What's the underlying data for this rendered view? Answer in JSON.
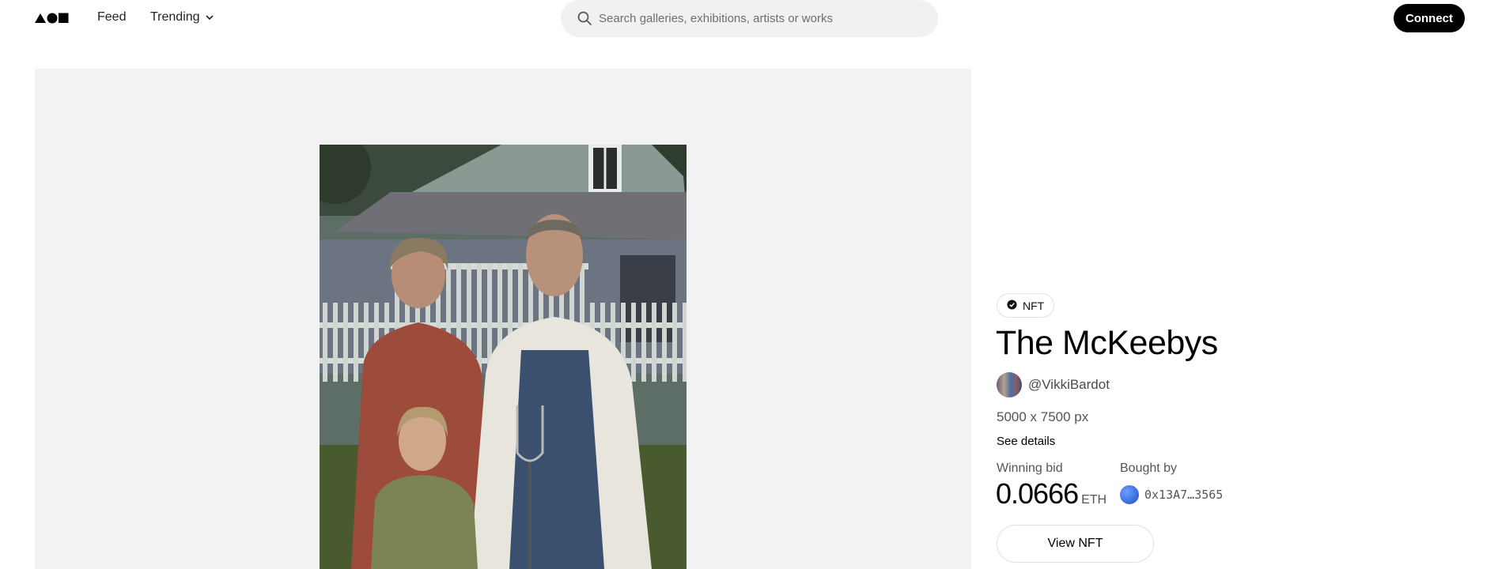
{
  "header": {
    "logo_icon": "foundation-logo-icon",
    "nav": {
      "feed_label": "Feed",
      "trending_label": "Trending",
      "trending_icon": "chevron-down-icon"
    },
    "search": {
      "icon": "search-icon",
      "placeholder": "Search galleries, exhibitions, artists or works"
    },
    "connect_label": "Connect"
  },
  "artwork": {
    "badge": {
      "icon": "verified-badge-icon",
      "label": "NFT"
    },
    "title": "The McKeebys",
    "artist_handle": "@VikkiBardot",
    "dimensions": "5000 x 7500 px",
    "see_details_label": "See details",
    "winning_bid_label": "Winning bid",
    "winning_bid_value": "0.0666",
    "winning_bid_currency": "ETH",
    "bought_by_label": "Bought by",
    "buyer_address": "0x13A7…3565",
    "view_button_label": "View NFT"
  },
  "colors": {
    "accent": "#000000",
    "panel_background": "#f2f2f2",
    "search_background": "#f1f1f1",
    "muted_text": "#555555"
  }
}
